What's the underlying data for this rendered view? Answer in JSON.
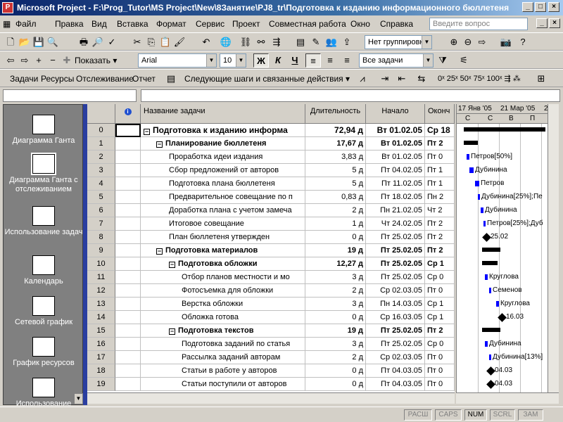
{
  "window": {
    "title": "Microsoft Project - F:\\Prog_Tutor\\MS Project\\New\\8Занятие\\PJ8_tr\\Подготовка к изданию информационного бюллетеня"
  },
  "menu": [
    "Файл",
    "Правка",
    "Вид",
    "Вставка",
    "Формат",
    "Сервис",
    "Проект",
    "Совместная работа",
    "Окно",
    "Справка"
  ],
  "help_box": {
    "placeholder": "Введите вопрос"
  },
  "toolbar1": {
    "grouping": "Нет группировки"
  },
  "toolbar2": {
    "show_label": "Показать",
    "font": "Arial",
    "size": "10",
    "filter": "Все задачи"
  },
  "toolbar3": {
    "tabs": [
      "Задачи",
      "Ресурсы",
      "Отслеживание",
      "Отчет"
    ],
    "next_steps": "Следующие шаги и связанные действия"
  },
  "views": [
    {
      "label": "Диаграмма Ганта"
    },
    {
      "label": "Диаграмма Ганта с отслеживанием"
    },
    {
      "label": "Использование задач"
    },
    {
      "label": "Календарь"
    },
    {
      "label": "Сетевой график"
    },
    {
      "label": "График ресурсов"
    },
    {
      "label": "Использование"
    }
  ],
  "columns": {
    "name": "Название задачи",
    "duration": "Длительность",
    "start": "Начало",
    "finish": "Оконч"
  },
  "gantt_header": {
    "weeks": [
      "17 Янв '05",
      "21 Мар '05",
      "2"
    ],
    "days": [
      "С",
      "С",
      "В",
      "П"
    ]
  },
  "tasks": [
    {
      "id": "0",
      "name": "Подготовка к изданию информа",
      "dur": "72,94 д",
      "start": "Вт 01.02.05",
      "finish": "Ср 18",
      "level": 0,
      "summary": true
    },
    {
      "id": "1",
      "name": "Планирование бюллетеня",
      "dur": "17,67 д",
      "start": "Вт 01.02.05",
      "finish": "Пт 2",
      "level": 1,
      "summary": true
    },
    {
      "id": "2",
      "name": "Проработка идеи издания",
      "dur": "3,83 д",
      "start": "Вт 01.02.05",
      "finish": "Пт 0",
      "level": 2,
      "summary": false
    },
    {
      "id": "3",
      "name": "Сбор предложений от авторов",
      "dur": "5 д",
      "start": "Пт 04.02.05",
      "finish": "Пт 1",
      "level": 2,
      "summary": false
    },
    {
      "id": "4",
      "name": "Подготовка плана бюллетеня",
      "dur": "5 д",
      "start": "Пт 11.02.05",
      "finish": "Пт 1",
      "level": 2,
      "summary": false
    },
    {
      "id": "5",
      "name": "Предварительное совещание по п",
      "dur": "0,83 д",
      "start": "Пт 18.02.05",
      "finish": "Пн 2",
      "level": 2,
      "summary": false
    },
    {
      "id": "6",
      "name": "Доработка плана с учетом замеча",
      "dur": "2 д",
      "start": "Пн 21.02.05",
      "finish": "Чт 2",
      "level": 2,
      "summary": false
    },
    {
      "id": "7",
      "name": "Итоговое совещание",
      "dur": "1 д",
      "start": "Чт 24.02.05",
      "finish": "Пт 2",
      "level": 2,
      "summary": false
    },
    {
      "id": "8",
      "name": "План бюллетеня утвержден",
      "dur": "0 д",
      "start": "Пт 25.02.05",
      "finish": "Пт 2",
      "level": 2,
      "summary": false
    },
    {
      "id": "9",
      "name": "Подготовка материалов",
      "dur": "19 д",
      "start": "Пт 25.02.05",
      "finish": "Пт 2",
      "level": 1,
      "summary": true
    },
    {
      "id": "10",
      "name": "Подготовка обложки",
      "dur": "12,27 д",
      "start": "Пт 25.02.05",
      "finish": "Ср 1",
      "level": 2,
      "summary": true
    },
    {
      "id": "11",
      "name": "Отбор планов местности и мо",
      "dur": "3 д",
      "start": "Пт 25.02.05",
      "finish": "Ср 0",
      "level": 3,
      "summary": false
    },
    {
      "id": "12",
      "name": "Фотосъемка для обложки",
      "dur": "2 д",
      "start": "Ср 02.03.05",
      "finish": "Пт 0",
      "level": 3,
      "summary": false
    },
    {
      "id": "13",
      "name": "Верстка обложки",
      "dur": "3 д",
      "start": "Пн 14.03.05",
      "finish": "Ср 1",
      "level": 3,
      "summary": false
    },
    {
      "id": "14",
      "name": "Обложка готова",
      "dur": "0 д",
      "start": "Ср 16.03.05",
      "finish": "Ср 1",
      "level": 3,
      "summary": false
    },
    {
      "id": "15",
      "name": "Подготовка текстов",
      "dur": "19 д",
      "start": "Пт 25.02.05",
      "finish": "Пт 2",
      "level": 2,
      "summary": true
    },
    {
      "id": "16",
      "name": "Подготовка заданий по статья",
      "dur": "3 д",
      "start": "Пт 25.02.05",
      "finish": "Ср 0",
      "level": 3,
      "summary": false
    },
    {
      "id": "17",
      "name": "Рассылка заданий авторам",
      "dur": "2 д",
      "start": "Ср 02.03.05",
      "finish": "Пт 0",
      "level": 3,
      "summary": false
    },
    {
      "id": "18",
      "name": "Статьи в работе у авторов",
      "dur": "0 д",
      "start": "Пт 04.03.05",
      "finish": "Пт 0",
      "level": 3,
      "summary": false
    },
    {
      "id": "19",
      "name": "Статьи поступили от авторов",
      "dur": "0 д",
      "start": "Пт 04.03.05",
      "finish": "Пт 0",
      "level": 3,
      "summary": false
    }
  ],
  "gantt_labels": [
    {
      "row": 2,
      "text": "Петров[50%]"
    },
    {
      "row": 3,
      "text": "Дубинина"
    },
    {
      "row": 4,
      "text": "Петров"
    },
    {
      "row": 5,
      "text": "Дубинина[25%];Пе"
    },
    {
      "row": 6,
      "text": "Дубинина"
    },
    {
      "row": 7,
      "text": "Петров[25%];Дуб"
    },
    {
      "row": 8,
      "text": "25.02"
    },
    {
      "row": 11,
      "text": "Круглова"
    },
    {
      "row": 12,
      "text": "Семенов"
    },
    {
      "row": 13,
      "text": "Круглова"
    },
    {
      "row": 14,
      "text": "16.03"
    },
    {
      "row": 16,
      "text": "Дубинина"
    },
    {
      "row": 17,
      "text": "Дубинина[13%]"
    },
    {
      "row": 18,
      "text": "04.03"
    },
    {
      "row": 19,
      "text": "04.03"
    }
  ],
  "status": {
    "items": [
      "РАСШ",
      "CAPS",
      "NUM",
      "SCRL",
      "ЗАМ"
    ],
    "active": "NUM"
  }
}
